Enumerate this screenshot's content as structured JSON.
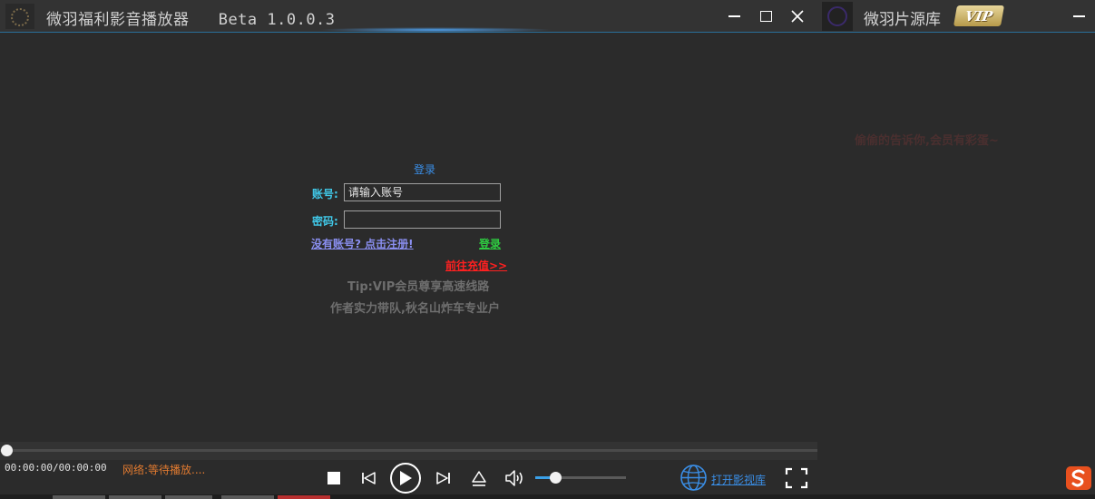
{
  "titlebar": {
    "app_title": "微羽福利影音播放器   Beta 1.0.0.3",
    "source_title": "微羽片源库",
    "vip_badge": "VIP"
  },
  "login": {
    "title": "登录",
    "account_label": "账号:",
    "account_placeholder": "请输入账号",
    "password_label": "密码:",
    "password_value": "",
    "register_link": "没有账号? 点击注册!",
    "login_button": "登录",
    "recharge_link": "前往充值>>",
    "tip": "Tip:VIP会员尊享高速线路",
    "author": "作者实力带队,秋名山炸车专业户"
  },
  "side_panel": {
    "secret_text": "偷偷的告诉你,会员有彩蛋~"
  },
  "player": {
    "time_display": "00:00:00/00:00:00",
    "network_status": "网络:等待播放....",
    "progress": 0,
    "volume": 0.22,
    "open_library_link": "打开影视库"
  },
  "colors": {
    "background": "#2b2b2b",
    "accent_blue": "#3a8ee6",
    "label_cyan": "#40c8e8",
    "login_green": "#2ecc40",
    "recharge_red": "#ff2020",
    "status_orange": "#e07a30"
  },
  "icons": {
    "app_logo": "app-logo-icon",
    "minimize": "minimize-icon",
    "maximize": "maximize-icon",
    "close": "close-icon",
    "stop": "stop-icon",
    "previous": "previous-icon",
    "play": "play-icon",
    "next": "next-icon",
    "eject": "eject-icon",
    "volume": "volume-icon",
    "globe": "globe-icon",
    "fullscreen": "fullscreen-icon",
    "input_method": "sogou-icon"
  }
}
